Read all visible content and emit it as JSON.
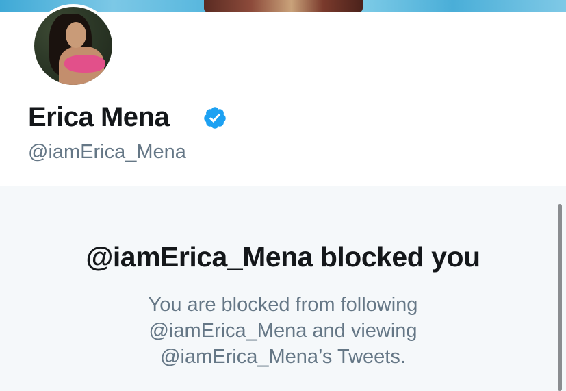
{
  "profile": {
    "display_name": "Erica Mena",
    "handle": "@iamErica_Mena",
    "verified": true
  },
  "blocked_notice": {
    "title": "@iamErica_Mena blocked you",
    "description_lines": [
      "You are blocked from following",
      "@iamErica_Mena and viewing",
      "@iamErica_Mena’s Tweets."
    ]
  },
  "icons": {
    "verified": "verified-badge-icon"
  },
  "colors": {
    "primary_text": "#14171a",
    "secondary_text": "#657786",
    "verified_blue": "#1da1f2",
    "panel_background": "#f5f8fa"
  }
}
